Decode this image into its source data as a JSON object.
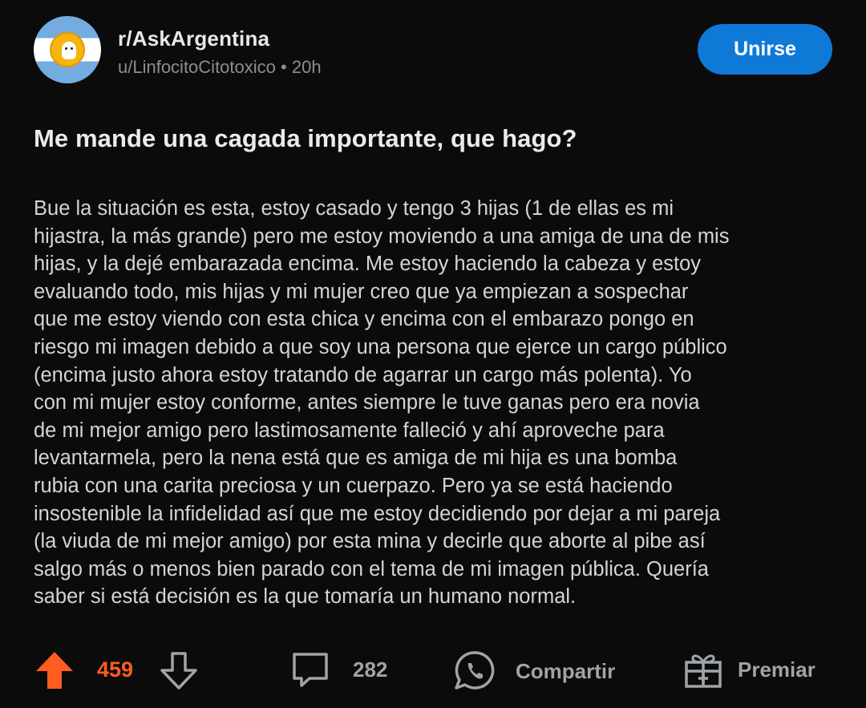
{
  "header": {
    "subreddit": "r/AskArgentina",
    "author": "u/LinfocitoCitotoxico",
    "separator": "•",
    "age": "20h",
    "join_label": "Unirse",
    "avatar_icon": "subreddit-avatar-icon"
  },
  "post": {
    "title": "Me mande una cagada importante, que hago?",
    "body_lines": [
      "Bue la situación es esta, estoy casado y tengo 3 hijas (1 de ellas es mi",
      "hijastra, la más grande) pero me estoy moviendo a una amiga de una de mis",
      "hijas, y la dejé embarazada encima. Me estoy haciendo la cabeza y estoy",
      "evaluando todo, mis hijas y mi mujer creo que ya empiezan a sospechar",
      "que me estoy viendo con esta chica y encima con el embarazo pongo en",
      "riesgo mi imagen debido a que soy una persona que ejerce un cargo público",
      "(encima justo ahora estoy tratando de agarrar un cargo más polenta). Yo",
      "con mi mujer estoy conforme, antes siempre le tuve ganas pero era novia",
      "de mi mejor amigo pero lastimosamente falleció y ahí aproveche para",
      "levantarmela, pero la nena está que es amiga de mi hija es una bomba",
      "rubia con una carita preciosa y un cuerpazo. Pero ya se está haciendo",
      "insostenible la infidelidad así que me estoy decidiendo por dejar a mi pareja",
      "(la viuda de mi mejor amigo) por esta mina y decirle que aborte al pibe así",
      "salgo más o menos bien parado con el tema de mi imagen pública. Quería",
      "saber si está decisión es la que tomaría un humano normal."
    ]
  },
  "actions": {
    "votes": "459",
    "comments": "282",
    "share_label": "Compartir",
    "award_label": "Premiar"
  },
  "colors": {
    "background": "#0b0b0b",
    "join_button": "#0f79d8",
    "upvote_active": "#ff5c1f",
    "secondary_text": "#8a8f93"
  }
}
